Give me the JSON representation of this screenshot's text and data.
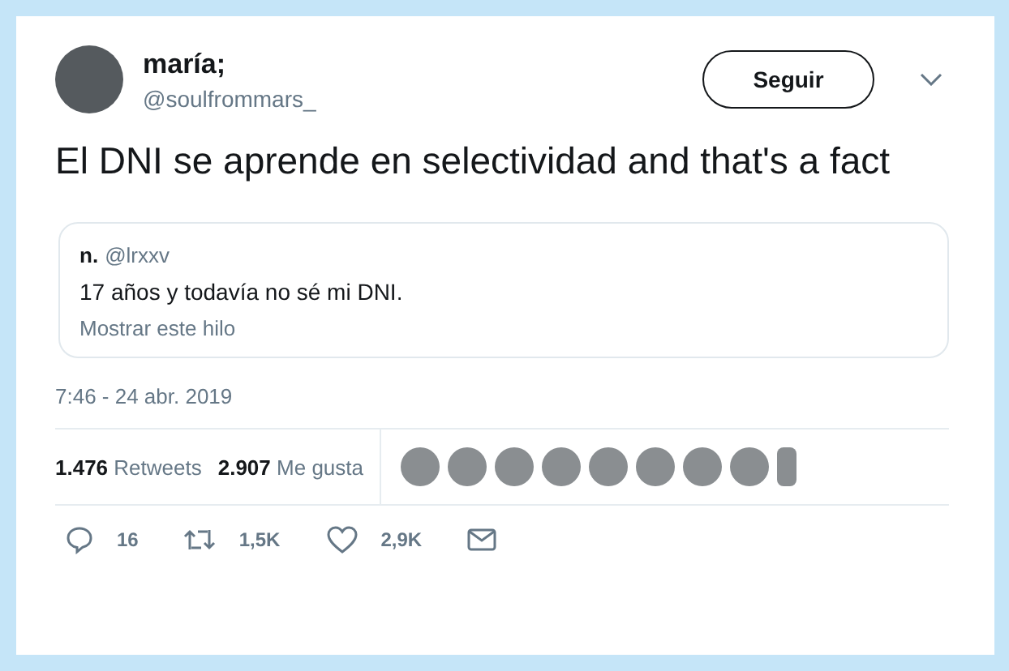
{
  "author": {
    "name": "maría;",
    "handle": "@soulfrommars_"
  },
  "follow_button": "Seguir",
  "tweet_text": "El DNI se aprende en selectividad and that's a fact",
  "quoted_tweet": {
    "name": "n.",
    "handle": "@lrxxv",
    "text": "17 años y todavía no sé mi DNI.",
    "link": "Mostrar este hilo"
  },
  "timestamp": "7:46 - 24 abr. 2019",
  "stats": [
    {
      "count": "1.476",
      "label": "Retweets"
    },
    {
      "count": "2.907",
      "label": "Me gusta"
    }
  ],
  "actions": [
    {
      "kind": "reply",
      "count": "16"
    },
    {
      "kind": "retweet",
      "count": "1,5K"
    },
    {
      "kind": "like",
      "count": "2,9K"
    },
    {
      "kind": "message"
    }
  ]
}
